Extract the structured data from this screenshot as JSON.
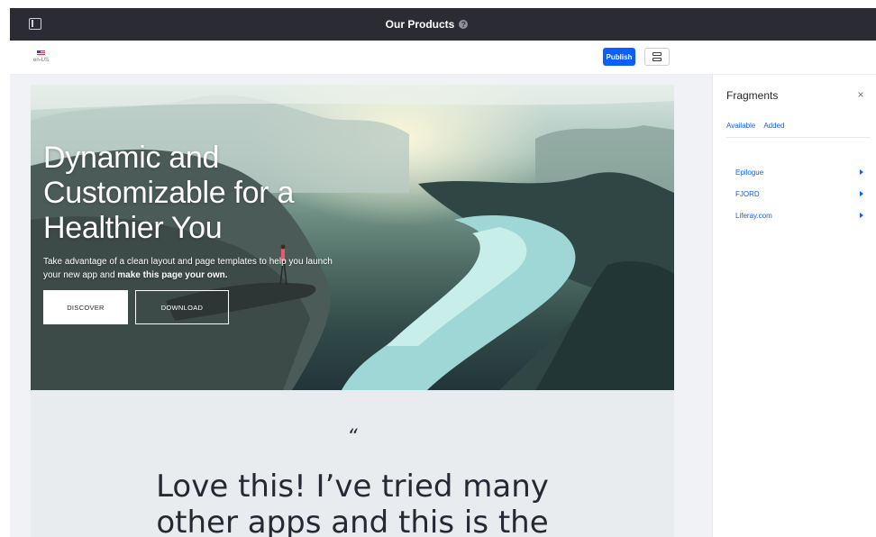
{
  "header": {
    "title": "Our Products",
    "help_icon": "help-icon",
    "sidebar_icon": "sidebar-toggle-icon"
  },
  "toolbar": {
    "locale_label": "en-US",
    "locale_icon": "us-flag-icon",
    "publish_label": "Publish",
    "view_icon": "layout-toggle-icon"
  },
  "hero": {
    "title": "Dynamic and Customizable for a Healthier You",
    "lead_plain": "Take advantage of a clean layout and page templates to help you launch your new app and ",
    "lead_bold": "make this page your own.",
    "discover_label": "DISCOVER",
    "download_label": "DOWNLOAD"
  },
  "quote": {
    "mark": "“",
    "text": "Love this! I’ve tried many other apps and this is the"
  },
  "panel": {
    "title": "Fragments",
    "close_icon": "close-icon",
    "tabs": [
      {
        "label": "Available"
      },
      {
        "label": "Added"
      }
    ],
    "items": [
      {
        "label": "Epilogue"
      },
      {
        "label": "FJORD"
      },
      {
        "label": "Liferay.com"
      }
    ]
  },
  "colors": {
    "topbar": "#2b2c33",
    "primary": "#0b5fff",
    "canvas": "#f1f2f5"
  }
}
